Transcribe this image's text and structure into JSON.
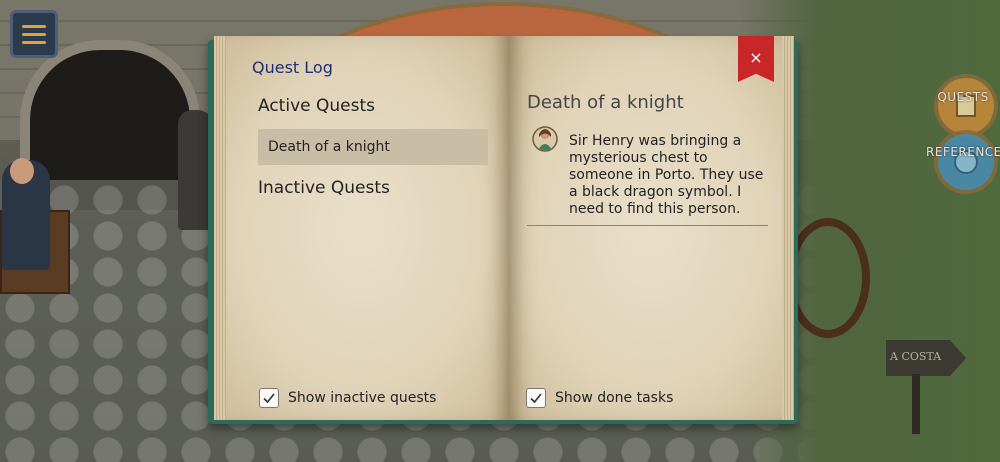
{
  "quest_log": {
    "title": "Quest Log",
    "active_heading": "Active Quests",
    "active_quests": [
      "Death of a knight"
    ],
    "inactive_heading": "Inactive Quests",
    "show_inactive_label": "Show inactive quests",
    "show_inactive_checked": true
  },
  "quest_detail": {
    "title": "Death of a knight",
    "tasks": [
      "Sir Henry was bringing a mysterious chest to someone in Porto. They use a black dragon symbol. I need to find this person."
    ],
    "show_done_label": "Show done tasks",
    "show_done_checked": true
  },
  "close_label": "×",
  "side_buttons": {
    "quests_label": "QUESTS",
    "reference_label": "REFERENCE"
  },
  "scene": {
    "signpost_text": "A COSTA"
  },
  "colors": {
    "title_blue": "#1c2f78",
    "selected_row": "#c9bda6",
    "close_red": "#c9262a",
    "book_cover": "#2e6a5a",
    "menu_bar": "#e0a33a"
  },
  "icons": {
    "check": "✓",
    "menu": "hamburger-icon",
    "journal": "book-icon",
    "task": "character-portrait-icon"
  }
}
